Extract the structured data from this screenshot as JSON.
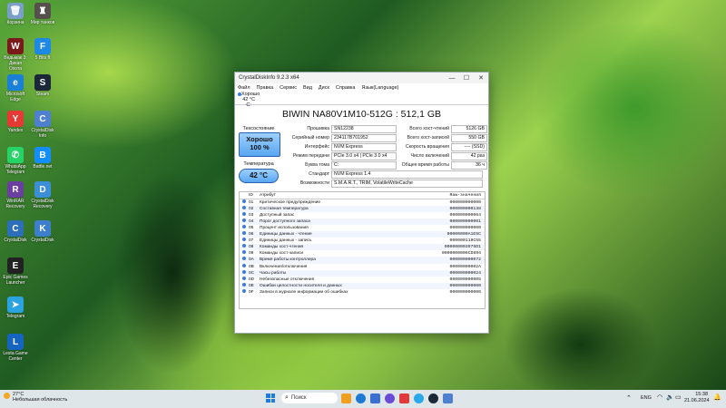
{
  "desktop": {
    "icons": [
      {
        "label": "Корзина",
        "color": "#7aa0c8",
        "glyph": "🗑"
      },
      {
        "label": "Мир танков",
        "color": "#55504a",
        "glyph": "♜"
      },
      {
        "label": "Ведьмак 3:\nДикая Охота",
        "color": "#7b1a1a",
        "glyph": "W"
      },
      {
        "label": "5 Bits ft",
        "color": "#1e88e5",
        "glyph": "F"
      },
      {
        "label": "Microsoft Edge",
        "color": "#1a7fd6",
        "glyph": "e"
      },
      {
        "label": "Steam",
        "color": "#1b2838",
        "glyph": "S"
      },
      {
        "label": "Yandex",
        "color": "#e53935",
        "glyph": "Y"
      },
      {
        "label": "CrystalDisk\nInfo",
        "color": "#4f7fcf",
        "glyph": "C"
      },
      {
        "label": "WhatsApp\nTelegram",
        "color": "#25d366",
        "glyph": "✆"
      },
      {
        "label": "Battle.net",
        "color": "#148eff",
        "glyph": "B"
      },
      {
        "label": "WinRAR\nRecovery",
        "color": "#6a3fa0",
        "glyph": "R"
      },
      {
        "label": "CrystalDisk\nRecovery",
        "color": "#3c8fd6",
        "glyph": "D"
      },
      {
        "label": "CrystalDisk",
        "color": "#2c6fb8",
        "glyph": "C"
      },
      {
        "label": "CrystalDisk",
        "color": "#3d7fca",
        "glyph": "K"
      },
      {
        "label": "Epic Games\nLauncher",
        "color": "#222",
        "glyph": "E"
      },
      {
        "label": "Telegram",
        "color": "#2aa3e0",
        "glyph": "➤"
      },
      {
        "label": "Lesta Game\nCenter",
        "color": "#1565c0",
        "glyph": "L"
      }
    ]
  },
  "window": {
    "title": "CrystalDiskInfo 9.2.3 x64",
    "controls": {
      "minimize": "—",
      "maximize": "☐",
      "close": "✕"
    },
    "menu": [
      "Файл",
      "Правка",
      "Сервис",
      "Вид",
      "Диск",
      "Справка",
      "Язык(Language)"
    ],
    "disk_tab": {
      "status": "Хорошо",
      "temp": "42 °C",
      "letter": "C:"
    },
    "model": "BIWIN NA80V1M10-512G : 512,1 GB",
    "health_label": "Техсостояние",
    "health_status": "Хорошо",
    "health_percent": "100 %",
    "temp_label": "Температура",
    "temp_value": "42 °C",
    "fields_left": [
      {
        "label": "Прошивка",
        "value": "SN12238"
      },
      {
        "label": "Серийный номер",
        "value": "234117B701952"
      },
      {
        "label": "Интерфейс",
        "value": "NVM Express"
      },
      {
        "label": "Режим передачи",
        "value": "PCIe 3.0 x4 | PCIe 3.0 x4"
      },
      {
        "label": "Буква тома",
        "value": "C:"
      }
    ],
    "fields_right": [
      {
        "label": "Всего хост-чтений",
        "value": "5126 GB"
      },
      {
        "label": "Всего хост-записей",
        "value": "550 GB"
      },
      {
        "label": "Скорость вращения",
        "value": "---- (SSD)"
      },
      {
        "label": "Число включений",
        "value": "42 раз"
      },
      {
        "label": "Общее время работы",
        "value": "36 ч"
      }
    ],
    "standard_label": "Стандарт",
    "standard_value": "NVM Express 1.4",
    "features_label": "Возможности",
    "features_value": "S.M.A.R.T., TRIM, VolatileWriteCache",
    "table": {
      "headers": {
        "id": "ID",
        "name": "Атрибут",
        "raw": "Raw-значения"
      },
      "rows": [
        {
          "id": "01",
          "name": "Критическое предупреждение",
          "raw": "000000000000"
        },
        {
          "id": "02",
          "name": "Составная температура",
          "raw": "000000000138"
        },
        {
          "id": "03",
          "name": "Доступный запас",
          "raw": "000000000064"
        },
        {
          "id": "04",
          "name": "Порог доступного запаса",
          "raw": "000000000001"
        },
        {
          "id": "05",
          "name": "Процент использования",
          "raw": "000000000000"
        },
        {
          "id": "06",
          "name": "Единицы данных - чтение",
          "raw": "00000000A1E5C"
        },
        {
          "id": "07",
          "name": "Единицы данных - запись",
          "raw": "000000119C55"
        },
        {
          "id": "08",
          "name": "Команды хост-чтения",
          "raw": "000000003975D1"
        },
        {
          "id": "09",
          "name": "Команды хост-записи",
          "raw": "0000000006CD894"
        },
        {
          "id": "0A",
          "name": "Время работы контроллера",
          "raw": "000000000072"
        },
        {
          "id": "0B",
          "name": "Включения/отключения",
          "raw": "00000000002A"
        },
        {
          "id": "0C",
          "name": "Часы работы",
          "raw": "000000000024"
        },
        {
          "id": "0D",
          "name": "Небезопасные отключения",
          "raw": "000000000005"
        },
        {
          "id": "0E",
          "name": "Ошибки целостности носителя и данных",
          "raw": "000000000000"
        },
        {
          "id": "0F",
          "name": "Записи в журнале информации об ошибках",
          "raw": "000000000000"
        }
      ]
    }
  },
  "taskbar": {
    "weather_temp": "27°C",
    "weather_text": "Небольшая облачность",
    "search_placeholder": "Поиск",
    "lang": "ENG",
    "time": "15:38",
    "date": "21.06.2024"
  }
}
